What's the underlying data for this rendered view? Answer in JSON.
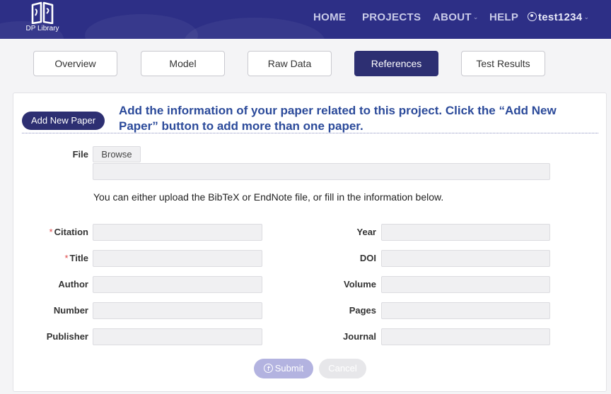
{
  "logo": {
    "text": "DP Library"
  },
  "nav": {
    "home": "HOME",
    "projects": "PROJECTS",
    "about": "ABOUT",
    "help": "HELP",
    "user": "test1234"
  },
  "tabs": [
    {
      "label": "Overview",
      "active": false
    },
    {
      "label": "Model",
      "active": false
    },
    {
      "label": "Raw Data",
      "active": false
    },
    {
      "label": "References",
      "active": true
    },
    {
      "label": "Test Results",
      "active": false
    }
  ],
  "references": {
    "add_button": "Add New Paper",
    "info": "Add the information of your paper related to this project. Click the “Add New Paper” button to add more than one paper.",
    "file_label": "File",
    "browse_label": "Browse",
    "file_path": "",
    "hint": "You can either upload the BibTeX or EndNote file, or fill in the information below.",
    "fields_left": [
      {
        "label": "Citation",
        "required": "*",
        "value": ""
      },
      {
        "label": "Title",
        "required": "*",
        "value": ""
      },
      {
        "label": "Author",
        "required": "",
        "value": ""
      },
      {
        "label": "Number",
        "required": "",
        "value": ""
      },
      {
        "label": "Publisher",
        "required": "",
        "value": ""
      }
    ],
    "fields_right": [
      {
        "label": "Year",
        "value": ""
      },
      {
        "label": "DOI",
        "value": ""
      },
      {
        "label": "Volume",
        "value": ""
      },
      {
        "label": "Pages",
        "value": ""
      },
      {
        "label": "Journal",
        "value": ""
      }
    ],
    "submit_label": "Submit",
    "cancel_label": "Cancel"
  },
  "colors": {
    "header_bg": "#2d2f86",
    "accent": "#2d2f72",
    "info_text": "#2b4a9a",
    "required": "#e04a4a",
    "submit_disabled": "#b3b3e0"
  },
  "icons": [
    "logo-book-icon",
    "chevron-down-icon",
    "user-icon",
    "upload-icon"
  ]
}
